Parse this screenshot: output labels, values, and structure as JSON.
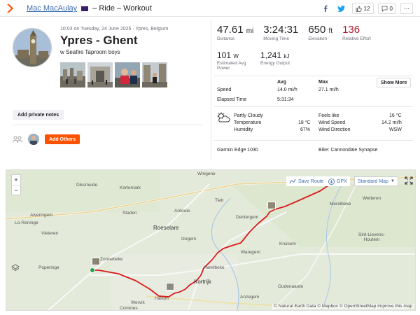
{
  "header": {
    "athlete_name": "Mac MacAulay",
    "separator": "– Ride – Workout",
    "kudos_count": "12",
    "comment_count": "0"
  },
  "activity": {
    "date_location": "10:03 on Tuesday, 24 June 2025 · Ypres, Belgium",
    "title": "Ypres - Ghent",
    "description": "w Seafire Taproom boys",
    "private_notes_label": "Add private notes",
    "add_others_label": "Add Others"
  },
  "stats": {
    "distance": {
      "value": "47.61",
      "unit": "mi",
      "label": "Distance"
    },
    "moving_time": {
      "value": "3:24:31",
      "label": "Moving Time"
    },
    "elevation": {
      "value": "650",
      "unit": "ft",
      "label": "Elevation"
    },
    "relative_effort": {
      "value": "136",
      "label": "Relative Effort"
    },
    "power": {
      "value": "101",
      "unit": "W",
      "label": "Estimated Avg Power"
    },
    "energy": {
      "value": "1,241",
      "unit": "kJ",
      "label": "Energy Output"
    }
  },
  "details": {
    "col_avg": "Avg",
    "col_max": "Max",
    "show_more": "Show More",
    "speed_label": "Speed",
    "speed_avg": "14.0 mi/h",
    "speed_max": "27.1 mi/h",
    "elapsed_label": "Elapsed Time",
    "elapsed_value": "5:31:34"
  },
  "weather": {
    "condition": "Partly Cloudy",
    "temperature_label": "Temperature",
    "temperature_value": "18 °C",
    "humidity_label": "Humidity",
    "humidity_value": "67%",
    "feels_like_label": "Feels like",
    "feels_like_value": "16 °C",
    "wind_speed_label": "Wind Speed",
    "wind_speed_value": "14.2 mi/h",
    "wind_direction_label": "Wind Direction",
    "wind_direction_value": "WSW"
  },
  "gear": {
    "device": "Garmin Edge 1030",
    "bike": "Bike: Cannondale Synapse"
  },
  "map": {
    "save_route": "Save Route",
    "gpx": "GPX",
    "style": "Standard Map",
    "attribution": "© Natural Earth Data © Mapbox © OpenStreetMap Improve this map",
    "places": [
      {
        "name": "Wingene",
        "id": "wingene"
      },
      {
        "name": "Diksmuide",
        "id": "diksmuide"
      },
      {
        "name": "Kortemark",
        "id": "kortemark"
      },
      {
        "name": "Tielt",
        "id": "tielt"
      },
      {
        "name": "Wetteren",
        "id": "wetteren"
      },
      {
        "name": "Merelbeke",
        "id": "merelbeke"
      },
      {
        "name": "Alveringem",
        "id": "alveringem"
      },
      {
        "name": "Staden",
        "id": "staden"
      },
      {
        "name": "Ardooie",
        "id": "ardooie"
      },
      {
        "name": "Dentergem",
        "id": "dentergem"
      },
      {
        "name": "Lo-Reninge",
        "id": "loreninge"
      },
      {
        "name": "Roeselare",
        "id": "roeselare"
      },
      {
        "name": "Sint-Lievens-Houtem",
        "id": "slh"
      },
      {
        "name": "Vleteren",
        "id": "vleteren"
      },
      {
        "name": "Izegem",
        "id": "izegem"
      },
      {
        "name": "Kruisem",
        "id": "kruisem"
      },
      {
        "name": "Zonnebeke",
        "id": "zonnebeke"
      },
      {
        "name": "Waregem",
        "id": "waregem"
      },
      {
        "name": "Poperinge",
        "id": "poperinge"
      },
      {
        "name": "Harelbeke",
        "id": "harelbeke"
      },
      {
        "name": "Kortrijk",
        "id": "kortrijk"
      },
      {
        "name": "Oudenaarde",
        "id": "oudenaarde"
      },
      {
        "name": "Anzegem",
        "id": "anzegem"
      },
      {
        "name": "Halluin",
        "id": "halluin"
      },
      {
        "name": "Wervik",
        "id": "wervik"
      },
      {
        "name": "Comines",
        "id": "comines"
      }
    ]
  }
}
